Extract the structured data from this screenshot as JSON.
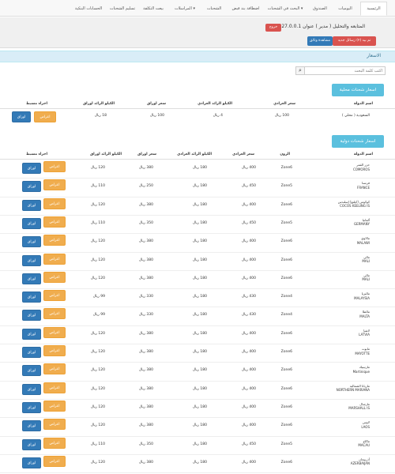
{
  "nav": {
    "tabs": [
      {
        "label": "الرئيسية"
      },
      {
        "label": "اليوميات"
      },
      {
        "label": "الصندوق"
      },
      {
        "label": "البحث في الشحنات ▾"
      },
      {
        "label": "اضطافة بند قبض"
      },
      {
        "label": "الشحنات"
      },
      {
        "label": "المراسلات ▾"
      },
      {
        "label": "بيعت التكلفة"
      },
      {
        "label": "تسليم الشحنات"
      },
      {
        "label": "الحسابات البنكية"
      }
    ]
  },
  "userbar": {
    "user_text": "المتابعه والتحليل ( مدير )   عنوان IP 127.0.0.1",
    "logout_label": "خروج",
    "pay_label": "تم بيد (٢) زسائل جديد",
    "view_label": "مشاهدة وثائق"
  },
  "prices": {
    "title": "الاسعار"
  },
  "search": {
    "placeholder": "اكتب كلمة البحث"
  },
  "local": {
    "section_label": "اسعار شحنات محلية",
    "headers": {
      "country": "اسم الدولة",
      "price_normal": "سعر العرادي",
      "extra_kg": "الكيلو الزائد العرادي",
      "price_paper": "سعر اوراق",
      "extra_paper": "الكيلو الزائد اوراق",
      "action": "اجراء مسبط"
    },
    "rows": [
      {
        "country": "السعودية ( محلي )",
        "price_normal": "100 ريال",
        "extra_kg": "4 ريال",
        "price_paper": "100 ريال",
        "extra_paper": "18 ريال",
        "btn_o": "اعراض",
        "btn_b": "اوراق"
      }
    ]
  },
  "intl": {
    "section_label": "اسعار شحنات دولية",
    "headers": {
      "country": "اسم الدولة",
      "zone": "الزون",
      "price_normal": "سعر العرادي",
      "extra_kg": "الكيلو الزائد العرادي",
      "price_paper": "سعر اوراق",
      "extra_paper": "الكيلو الزائد اوراق",
      "action": "اجراء مسبط"
    },
    "rows": [
      {
        "ar": "جزر القمر",
        "en": "COMOROS",
        "zone": "Zone6",
        "price_normal": "400 ريال",
        "extra_kg": "180 ريال",
        "price_paper": "380 ريال",
        "extra_paper": "120 ريال",
        "btn_o": "اعراض",
        "btn_b": "اوراق"
      },
      {
        "ar": "فرنسا",
        "en": "FRANCE",
        "zone": "Zone5",
        "price_normal": "450 ريال",
        "extra_kg": "180 ريال",
        "price_paper": "250 ريال",
        "extra_paper": "110 ريال",
        "btn_o": "اعراض",
        "btn_b": "اوراق"
      },
      {
        "ar": "كوكوس (كيلنغ) إسلندس",
        "en": "COCOS KEELING IS",
        "zone": "Zone6",
        "price_normal": "400 ريال",
        "extra_kg": "180 ريال",
        "price_paper": "380 ريال",
        "extra_paper": "120 ريال",
        "btn_o": "اعراض",
        "btn_b": "اوراق"
      },
      {
        "ar": "ألمانيا",
        "en": "GERMANY",
        "zone": "Zone5",
        "price_normal": "450 ريال",
        "extra_kg": "180 ريال",
        "price_paper": "350 ريال",
        "extra_paper": "110 ريال",
        "btn_o": "اعراض",
        "btn_b": "اوراق"
      },
      {
        "ar": "مالاوي",
        "en": "MALAWI",
        "zone": "Zone6",
        "price_normal": "400 ريال",
        "extra_kg": "180 ريال",
        "price_paper": "380 ريال",
        "extra_paper": "120 ريال",
        "btn_o": "اعراض",
        "btn_b": "اوراق"
      },
      {
        "ar": "مالي",
        "en": "MALI",
        "zone": "Zone6",
        "price_normal": "400 ريال",
        "extra_kg": "180 ريال",
        "price_paper": "380 ريال",
        "extra_paper": "120 ريال",
        "btn_o": "اعراض",
        "btn_b": "اوراق"
      },
      {
        "ar": "مالي",
        "en": "MALI",
        "zone": "Zone6",
        "price_normal": "400 ريال",
        "extra_kg": "180 ريال",
        "price_paper": "380 ريال",
        "extra_paper": "120 ريال",
        "btn_o": "اعراض",
        "btn_b": "اوراق"
      },
      {
        "ar": "ماليزيا",
        "en": "MALAYSIA",
        "zone": "Zone4",
        "price_normal": "430 ريال",
        "extra_kg": "180 ريال",
        "price_paper": "330 ريال",
        "extra_paper": "99 ريال",
        "btn_o": "اعراض",
        "btn_b": "اوراق"
      },
      {
        "ar": "مالطا",
        "en": "MALTA",
        "zone": "Zone4",
        "price_normal": "430 ريال",
        "extra_kg": "180 ريال",
        "price_paper": "330 ريال",
        "extra_paper": "99 ريال",
        "btn_o": "اعراض",
        "btn_b": "اوراق"
      },
      {
        "ar": "لاتفيا",
        "en": "LATVIA",
        "zone": "Zone6",
        "price_normal": "400 ريال",
        "extra_kg": "180 ريال",
        "price_paper": "380 ريال",
        "extra_paper": "120 ريال",
        "btn_o": "اعراض",
        "btn_b": "اوراق"
      },
      {
        "ar": "مايوت",
        "en": "MAYOTTE",
        "zone": "Zone6",
        "price_normal": "400 ريال",
        "extra_kg": "180 ريال",
        "price_paper": "380 ريال",
        "extra_paper": "120 ريال",
        "btn_o": "اعراض",
        "btn_b": "اوراق"
      },
      {
        "ar": "مارتينيك",
        "en": "Martinique",
        "zone": "Zone6",
        "price_normal": "400 ريال",
        "extra_kg": "180 ريال",
        "price_paper": "380 ريال",
        "extra_paper": "120 ريال",
        "btn_o": "اعراض",
        "btn_b": "اوراق"
      },
      {
        "ar": "ماريانا الشمالية",
        "en": "NORTHERN MARIANA",
        "zone": "Zone6",
        "price_normal": "400 ريال",
        "extra_kg": "180 ريال",
        "price_paper": "380 ريال",
        "extra_paper": "120 ريال",
        "btn_o": "اعراض",
        "btn_b": "اوراق"
      },
      {
        "ar": "مارشال",
        "en": "MARSHALL IS",
        "zone": "Zone6",
        "price_normal": "400 ريال",
        "extra_kg": "180 ريال",
        "price_paper": "380 ريال",
        "extra_paper": "120 ريال",
        "btn_o": "اعراض",
        "btn_b": "اوراق"
      },
      {
        "ar": "لاوس",
        "en": "LAOS",
        "zone": "Zone6",
        "price_normal": "400 ريال",
        "extra_kg": "180 ريال",
        "price_paper": "380 ريال",
        "extra_paper": "120 ريال",
        "btn_o": "اعراض",
        "btn_b": "اوراق"
      },
      {
        "ar": "ماكاو",
        "en": "MACAU",
        "zone": "Zone5",
        "price_normal": "450 ريال",
        "extra_kg": "180 ريال",
        "price_paper": "350 ريال",
        "extra_paper": "110 ريال",
        "btn_o": "اعراض",
        "btn_b": "اوراق"
      },
      {
        "ar": "أذربيجان",
        "en": "AZERBAIJAN",
        "zone": "Zone6",
        "price_normal": "400 ريال",
        "extra_kg": "180 ريال",
        "price_paper": "380 ريال",
        "extra_paper": "120 ريال",
        "btn_o": "اعراض",
        "btn_b": "اوراق"
      }
    ]
  },
  "colors": {
    "danger": "#d9534f",
    "primary": "#337ab7",
    "warning": "#f0ad4e",
    "info": "#5bc0de",
    "header_bar": "#d9edf7"
  }
}
